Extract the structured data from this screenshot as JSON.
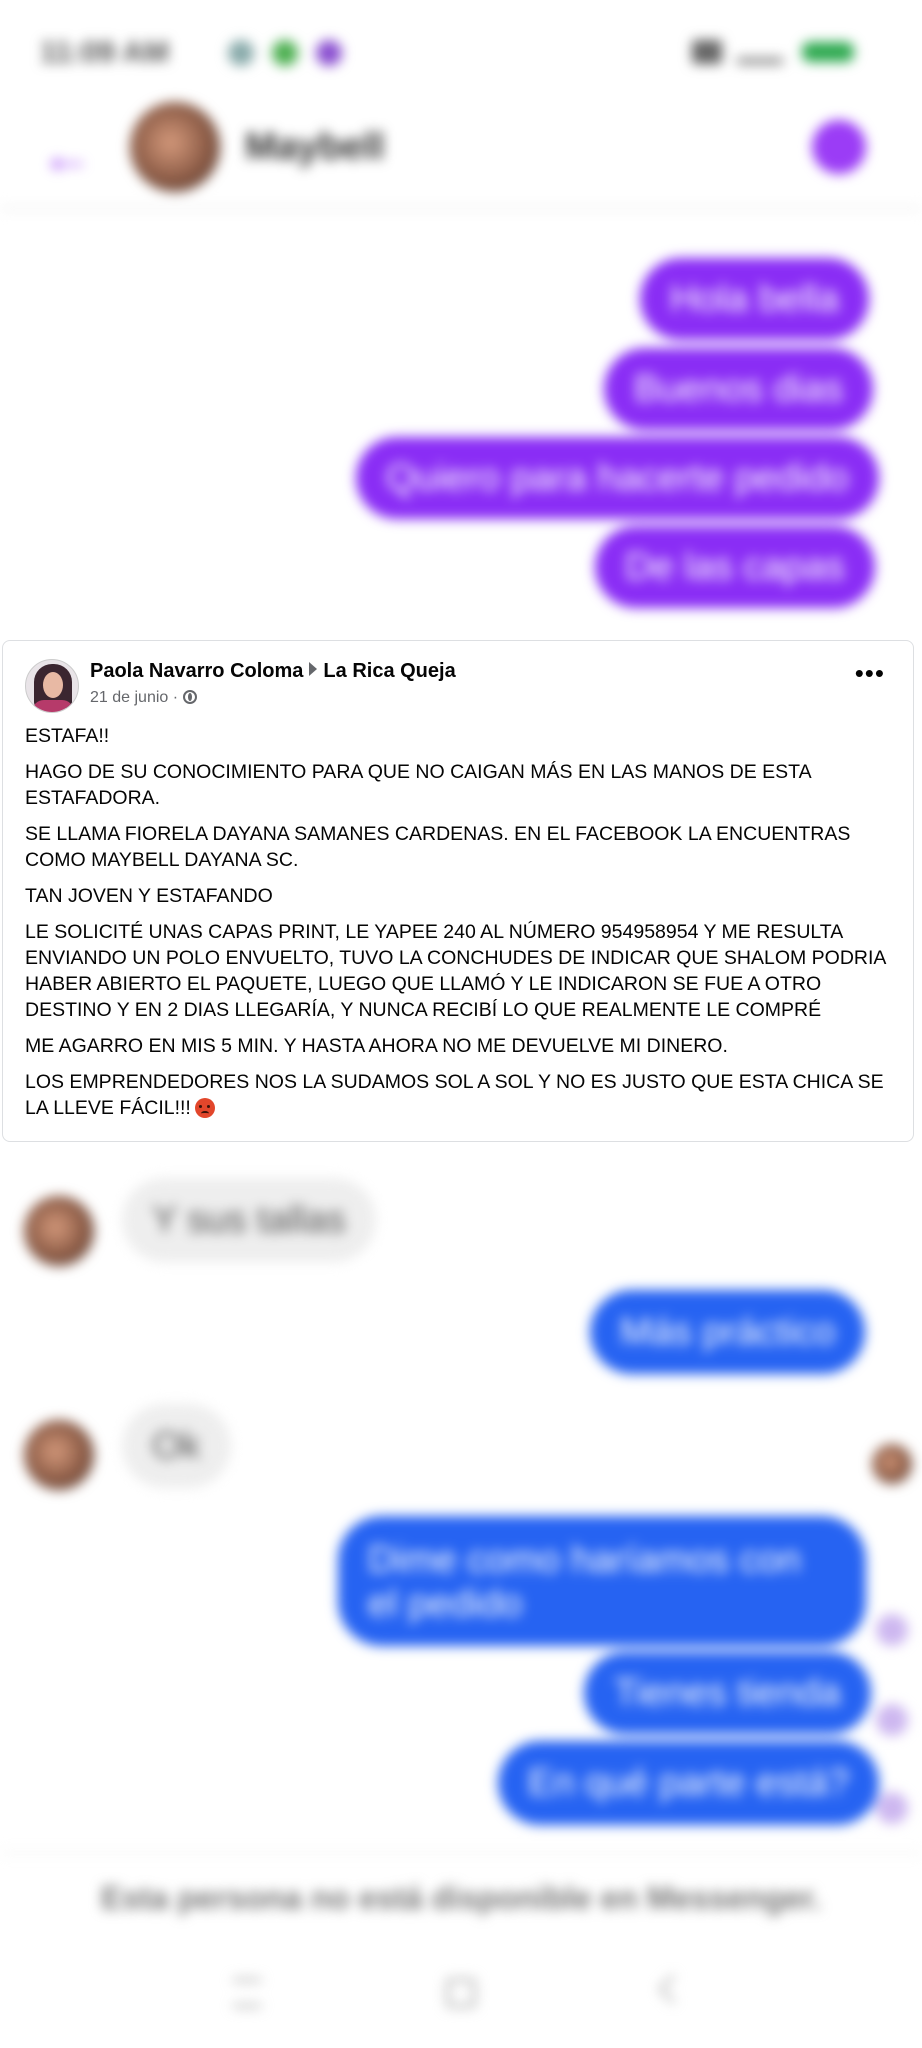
{
  "status_bar": {
    "time": "11:09 AM"
  },
  "header": {
    "contact_name": "Maybell",
    "back_icon": "back-arrow-icon",
    "action_icon": "info-icon",
    "accent_color": "#9b3cf6"
  },
  "messages_top": [
    {
      "text": "Hola bella"
    },
    {
      "text": "Buenos dias"
    },
    {
      "text": "Quiero para hacerte pedido"
    },
    {
      "text": "De las capas"
    }
  ],
  "messages_bottom": [
    {
      "text": "Y sus tallas",
      "side": "received"
    },
    {
      "text": "Más práctico",
      "side": "sent"
    },
    {
      "text": "Ok",
      "side": "received"
    },
    {
      "text": "Dime como haríamos con el pedido",
      "side": "sent"
    },
    {
      "text": "Tienes tienda",
      "side": "sent"
    },
    {
      "text": "En qué parte está?",
      "side": "sent"
    }
  ],
  "footer": {
    "note": "Esta persona no está disponible en Messenger."
  },
  "post": {
    "author": "Paola Navarro Coloma",
    "group": "La Rica Queja",
    "date": "21 de junio",
    "separator": "·",
    "more": "•••",
    "paragraphs": [
      "ESTAFA!!",
      "HAGO DE SU CONOCIMIENTO PARA QUE NO CAIGAN MÁS EN LAS MANOS DE ESTA ESTAFADORA.",
      "SE LLAMA FIORELA DAYANA SAMANES CARDENAS. EN EL FACEBOOK LA ENCUENTRAS COMO MAYBELL DAYANA SC.",
      "TAN JOVEN Y ESTAFANDO",
      "LE SOLICITÉ UNAS CAPAS PRINT, LE YAPEE 240 AL NÚMERO 954958954 Y ME RESULTA ENVIANDO UN POLO ENVUELTO, TUVO LA CONCHUDES DE INDICAR QUE SHALOM PODRIA HABER ABIERTO EL PAQUETE, LUEGO QUE LLAMÓ Y LE INDICARON SE FUE A OTRO DESTINO Y EN 2 DIAS LLEGARÍA, Y NUNCA RECIBÍ LO QUE REALMENTE LE COMPRÉ",
      "ME AGARRO EN MIS 5 MIN. Y HASTA AHORA NO ME DEVUELVE MI DINERO."
    ],
    "last_paragraph": "LOS EMPRENDEDORES NOS LA SUDAMOS SOL A SOL Y NO ES JUSTO QUE ESTA CHICA SE LA LLEVE FÁCIL!!!"
  }
}
